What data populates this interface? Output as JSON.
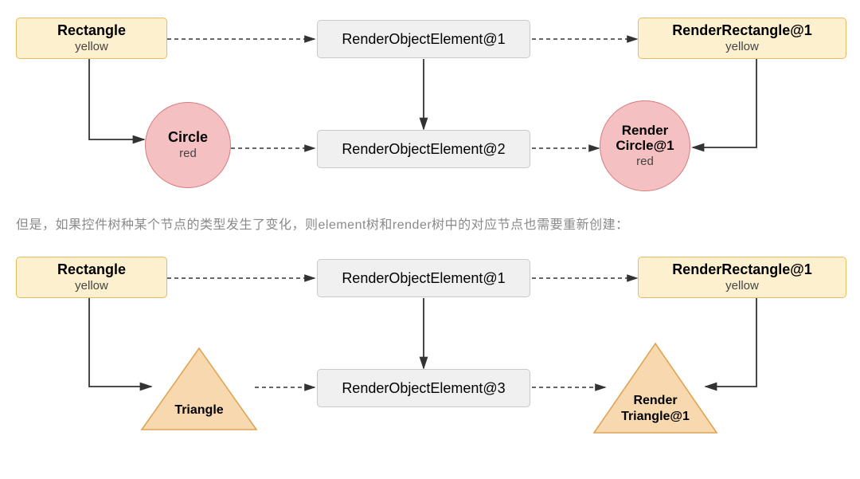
{
  "colors": {
    "yellowFill": "#fdf0cf",
    "yellowStroke": "#e7bb5f",
    "grayFill": "#f0f0f0",
    "grayStroke": "#c9c9c9",
    "redFill": "#f4c0c1",
    "redStroke": "#d77b7e",
    "orangeFill": "#f7d8af",
    "orangeStroke": "#e0a455",
    "arrow": "#333333"
  },
  "caption": "但是，如果控件树种某个节点的类型发生了变化，则element树和render树中的对应节点也需要重新创建：",
  "diagram1": {
    "rectWidget": {
      "title": "Rectangle",
      "subtitle": "yellow"
    },
    "circleWidget": {
      "title": "Circle",
      "subtitle": "red"
    },
    "element1": "RenderObjectElement@1",
    "element2": "RenderObjectElement@2",
    "renderRect": {
      "title": "RenderRectangle@1",
      "subtitle": "yellow"
    },
    "renderCircle": {
      "line1": "Render",
      "line2": "Circle@1",
      "subtitle": "red"
    }
  },
  "diagram2": {
    "rectWidget": {
      "title": "Rectangle",
      "subtitle": "yellow"
    },
    "triangleWidget": {
      "title": "Triangle"
    },
    "element1": "RenderObjectElement@1",
    "element3": "RenderObjectElement@3",
    "renderRect": {
      "title": "RenderRectangle@1",
      "subtitle": "yellow"
    },
    "renderTriangle": {
      "line1": "Render",
      "line2": "Triangle@1"
    }
  }
}
